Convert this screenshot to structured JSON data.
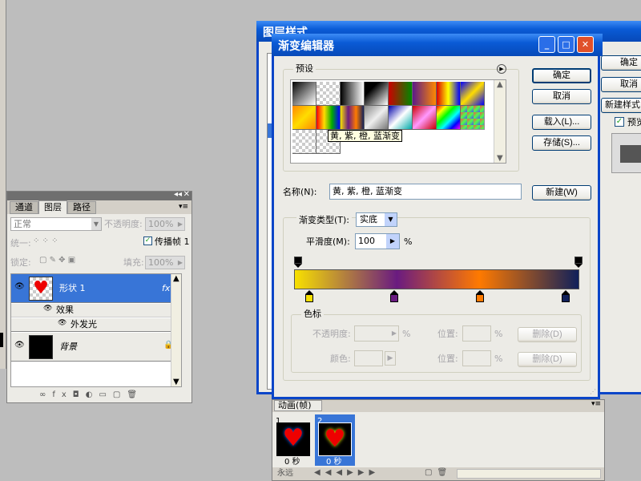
{
  "layers_panel": {
    "tabs": [
      "通道",
      "图层",
      "路径"
    ],
    "blend_mode": "正常",
    "opacity_label": "不透明度:",
    "opacity_value": "100%",
    "unify_label": "统一:",
    "propagate_label": "传播帧 1",
    "lock_label": "锁定:",
    "fill_label": "填充:",
    "fill_value": "100%",
    "layers": [
      {
        "name": "形状 1",
        "fx": "fx"
      },
      {
        "name": "效果"
      },
      {
        "name": "外发光"
      },
      {
        "name": "背景"
      }
    ]
  },
  "layer_style_dialog": {
    "title": "图层样式",
    "ok_label": "确定",
    "cancel_label": "取消",
    "new_style_label": "新建样式",
    "preview_label": "预览"
  },
  "gradient_editor": {
    "title": "渐变编辑器",
    "presets_label": "预设",
    "tooltip": "黄, 紫, 橙, 蓝渐变",
    "buttons": {
      "ok": "确定",
      "cancel": "取消",
      "load": "载入(L)...",
      "save": "存储(S)...",
      "new": "新建(W)"
    },
    "name_label": "名称(N):",
    "name_value": "黄, 紫, 橙, 蓝渐变",
    "type_label": "渐变类型(T):",
    "type_value": "实底",
    "smoothness_label": "平滑度(M):",
    "smoothness_value": "100",
    "percent": "%",
    "stops_group": {
      "title": "色标",
      "opacity_label": "不透明度:",
      "color_label": "颜色:",
      "location_label": "位置:",
      "percent": "%",
      "delete_label": "删除(D)"
    }
  },
  "animation_panel": {
    "title": "动画(帧)",
    "frames": [
      {
        "index": "1",
        "delay": "0 秒"
      },
      {
        "index": "2",
        "delay": "0 秒"
      }
    ],
    "loop": "永远"
  },
  "colors": {
    "title_bar": "#0a5bd6",
    "selection": "#3875d7",
    "dialog_bg": "#ecebe6",
    "gradient_stops": [
      "#f8e000",
      "#6a1b80",
      "#ff7a00",
      "#10205a"
    ]
  }
}
